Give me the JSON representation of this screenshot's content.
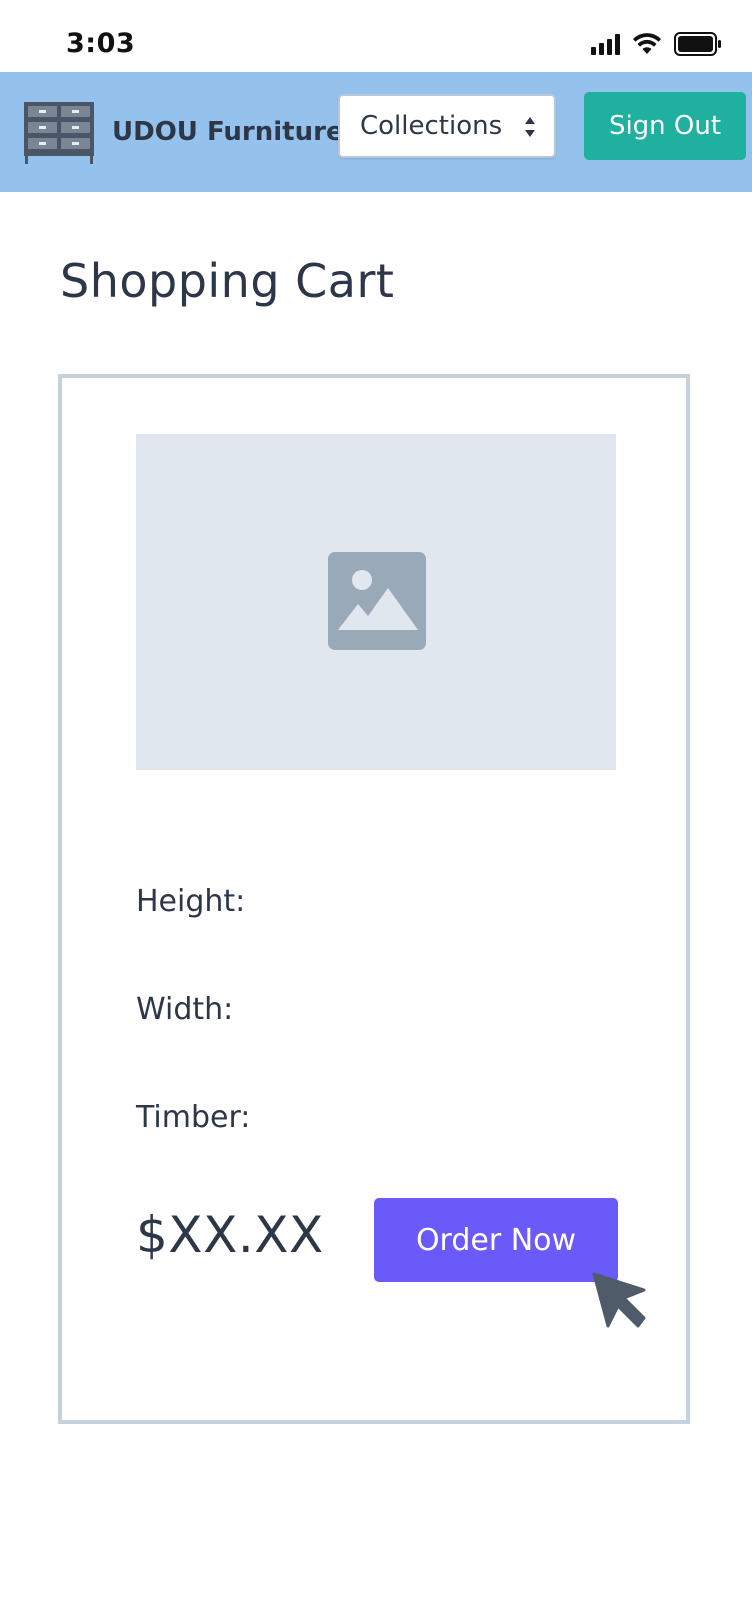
{
  "status_bar": {
    "time": "3:03",
    "icons": [
      "signal-icon",
      "wifi-icon",
      "battery-icon"
    ]
  },
  "header": {
    "logo_icon": "cabinet-icon",
    "brand": "UDOU Furniture",
    "collections_select": {
      "selected": "Collections",
      "icon": "up-down-arrows-icon"
    },
    "sign_out_label": "Sign Out",
    "colors": {
      "header_bg": "#95c2ec",
      "signout_bg": "#1fb0a0"
    }
  },
  "main": {
    "title": "Shopping Cart",
    "cart_item": {
      "image_icon": "image-placeholder-icon",
      "height_label": "Height:",
      "width_label": "Width:",
      "timber_label": "Timber:",
      "price": "$XX.XX",
      "order_button_label": "Order Now",
      "colors": {
        "order_button_bg": "#6a5af9",
        "image_bg": "#e1e7ef"
      }
    }
  },
  "pointer_icon": "mouse-cursor-icon"
}
